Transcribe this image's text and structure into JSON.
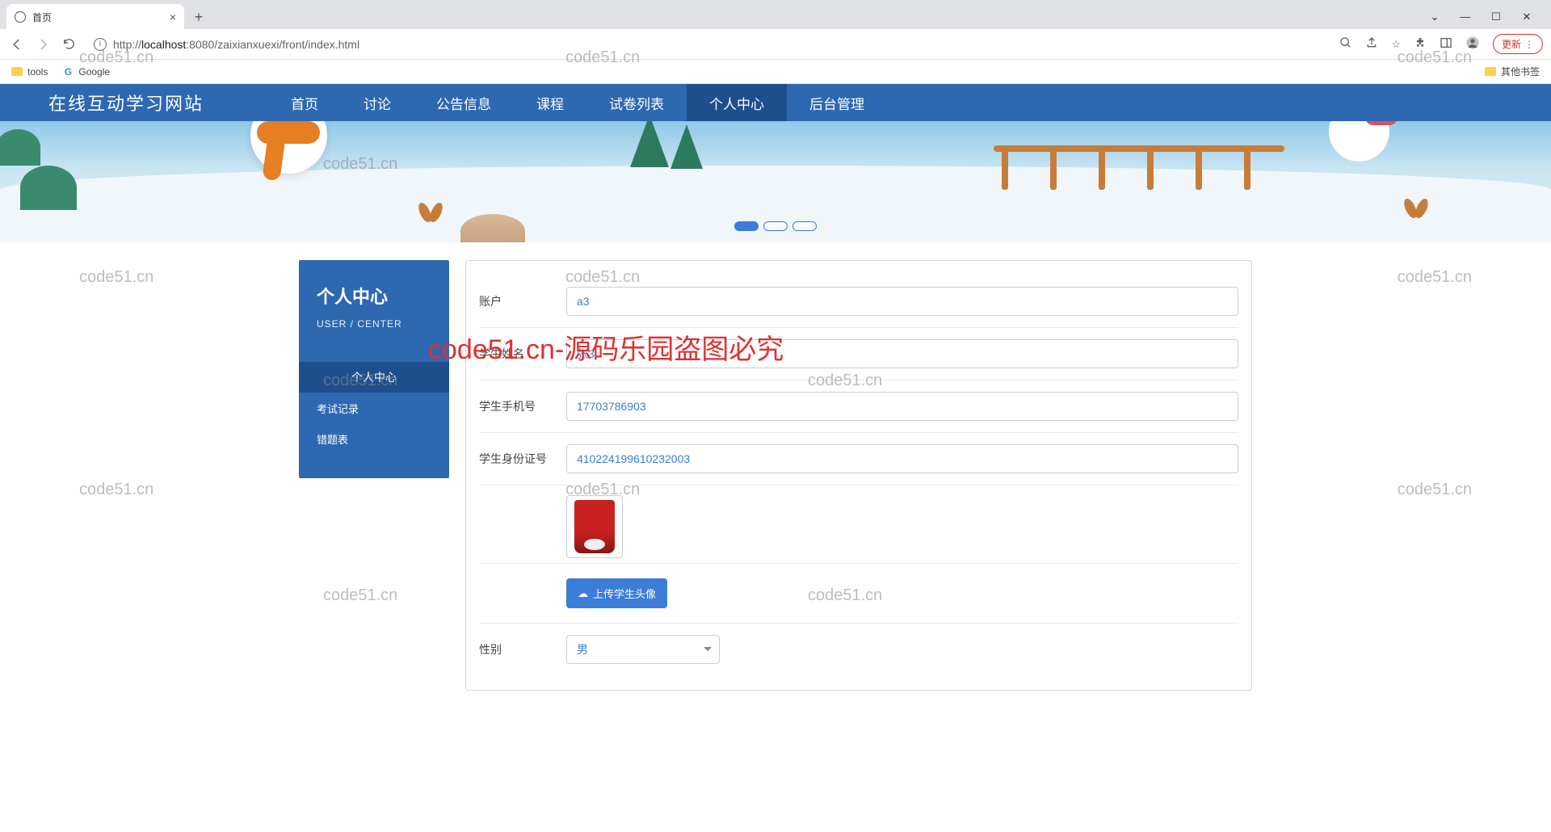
{
  "browser": {
    "tab_title": "首页",
    "url_prefix": "http://",
    "url_host": "localhost",
    "url_rest": ":8080/zaixianxuexi/front/index.html",
    "update_label": "更新",
    "bookmarks": {
      "tools": "tools",
      "google": "Google",
      "other": "其他书签"
    }
  },
  "nav": {
    "brand": "在线互动学习网站",
    "items": [
      "首页",
      "讨论",
      "公告信息",
      "课程",
      "试卷列表",
      "个人中心",
      "后台管理"
    ],
    "active_index": 5
  },
  "sidebar": {
    "title": "个人中心",
    "subtitle": "USER / CENTER",
    "items": [
      "个人中心",
      "考试记录",
      "错题表"
    ],
    "active_index": 0
  },
  "form": {
    "account": {
      "label": "账户",
      "value": "a3"
    },
    "name": {
      "label": "学生姓名",
      "value": "张3"
    },
    "phone": {
      "label": "学生手机号",
      "value": "17703786903"
    },
    "idcard": {
      "label": "学生身份证号",
      "value": "410224199610232003"
    },
    "upload_label": "上传学生头像",
    "gender": {
      "label": "性别",
      "value": "男"
    }
  },
  "watermarks": {
    "text": "code51.cn",
    "red": "code51.cn-源码乐园盗图必究"
  }
}
